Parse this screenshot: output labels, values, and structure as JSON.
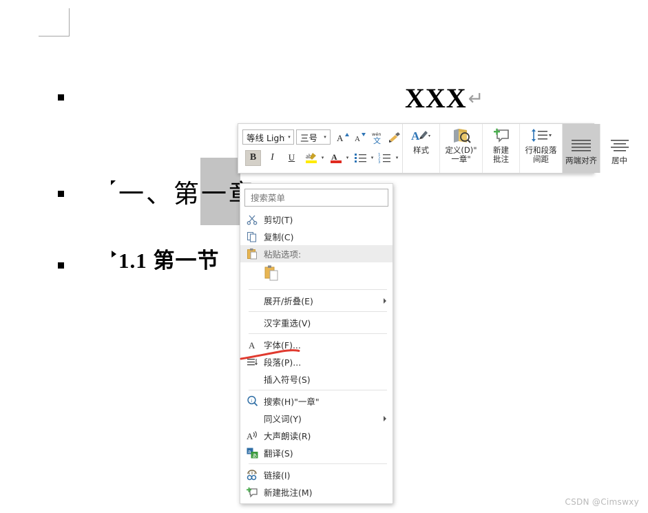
{
  "document": {
    "title_text": "XXX",
    "paragraph_mark": "↵",
    "headings": [
      {
        "text": "一、第一章",
        "level": 1,
        "state": "expanded"
      },
      {
        "text": "1.1 第一节",
        "level": 2,
        "state": "collapsed"
      }
    ],
    "gutter_bullets": 3,
    "selection": {
      "covers": "一章"
    }
  },
  "mini_toolbar": {
    "font_name": "等线 Light",
    "font_size": "三号",
    "dropdown_caret": "▾",
    "buttons": [
      {
        "name": "grow-font",
        "glyph": "A"
      },
      {
        "name": "shrink-font",
        "glyph": "A"
      },
      {
        "name": "phonetic-guide",
        "glyph": "文"
      },
      {
        "name": "format-painter",
        "glyph": "🖌"
      },
      {
        "name": "bold",
        "label": "B",
        "active": true
      },
      {
        "name": "italic",
        "label": "I",
        "active": false
      },
      {
        "name": "underline",
        "label": "U",
        "active": false
      },
      {
        "name": "text-highlight",
        "label": "ab",
        "active": false
      },
      {
        "name": "font-color",
        "label": "A",
        "active": false
      },
      {
        "name": "bullet-list",
        "active": false
      },
      {
        "name": "numbered-list",
        "active": false
      }
    ],
    "commands": [
      {
        "name": "styles",
        "label": "样式"
      },
      {
        "name": "define",
        "label": "定义(D)\"\n一章\""
      },
      {
        "name": "new-comment",
        "label": "新建\n批注"
      },
      {
        "name": "line-paragraph-spacing",
        "label": "行和段落\n间距"
      }
    ],
    "alignment": [
      {
        "name": "justify",
        "label": "两端对齐",
        "active": true
      },
      {
        "name": "center",
        "label": "居中",
        "active": false
      }
    ]
  },
  "context_menu": {
    "search_placeholder": "搜索菜单",
    "items": [
      {
        "label": "剪切(T)",
        "icon": "scissors-icon",
        "submenu": false,
        "highlight": false,
        "sep_after": false
      },
      {
        "label": "复制(C)",
        "icon": "copy-icon",
        "submenu": false,
        "highlight": false,
        "sep_after": false
      },
      {
        "label": "粘贴选项:",
        "icon": "paste-icon",
        "submenu": false,
        "highlight": true,
        "sep_after": false
      },
      {
        "label": "展开/折叠(E)",
        "icon": "none",
        "submenu": true,
        "highlight": false,
        "sep_after": false
      },
      {
        "label": "汉字重选(V)",
        "icon": "none",
        "submenu": false,
        "highlight": false,
        "sep_after": false
      },
      {
        "label": "字体(F)...",
        "icon": "font-icon",
        "submenu": false,
        "highlight": false,
        "sep_after": false
      },
      {
        "label": "段落(P)...",
        "icon": "paragraph-icon",
        "submenu": false,
        "highlight": false,
        "sep_after": false
      },
      {
        "label": "插入符号(S)",
        "icon": "none",
        "submenu": false,
        "highlight": false,
        "sep_after": true
      },
      {
        "label": "搜索(H)\"一章\"",
        "icon": "search-icon",
        "submenu": false,
        "highlight": false,
        "sep_after": false
      },
      {
        "label": "同义词(Y)",
        "icon": "none",
        "submenu": true,
        "highlight": false,
        "sep_after": false
      },
      {
        "label": "大声朗读(R)",
        "icon": "read-aloud-icon",
        "submenu": false,
        "highlight": false,
        "sep_after": false
      },
      {
        "label": "翻译(S)",
        "icon": "translate-icon",
        "submenu": false,
        "highlight": false,
        "sep_after": true
      },
      {
        "label": "链接(I)",
        "icon": "link-icon",
        "submenu": false,
        "highlight": false,
        "sep_after": false
      },
      {
        "label": "新建批注(M)",
        "icon": "comment-icon",
        "submenu": false,
        "highlight": false,
        "sep_after": false
      }
    ]
  },
  "annotation": {
    "color": "#e03a2f",
    "type": "hand-drawn-underline"
  },
  "watermark": {
    "text": "CSDN @Cimswxy"
  }
}
